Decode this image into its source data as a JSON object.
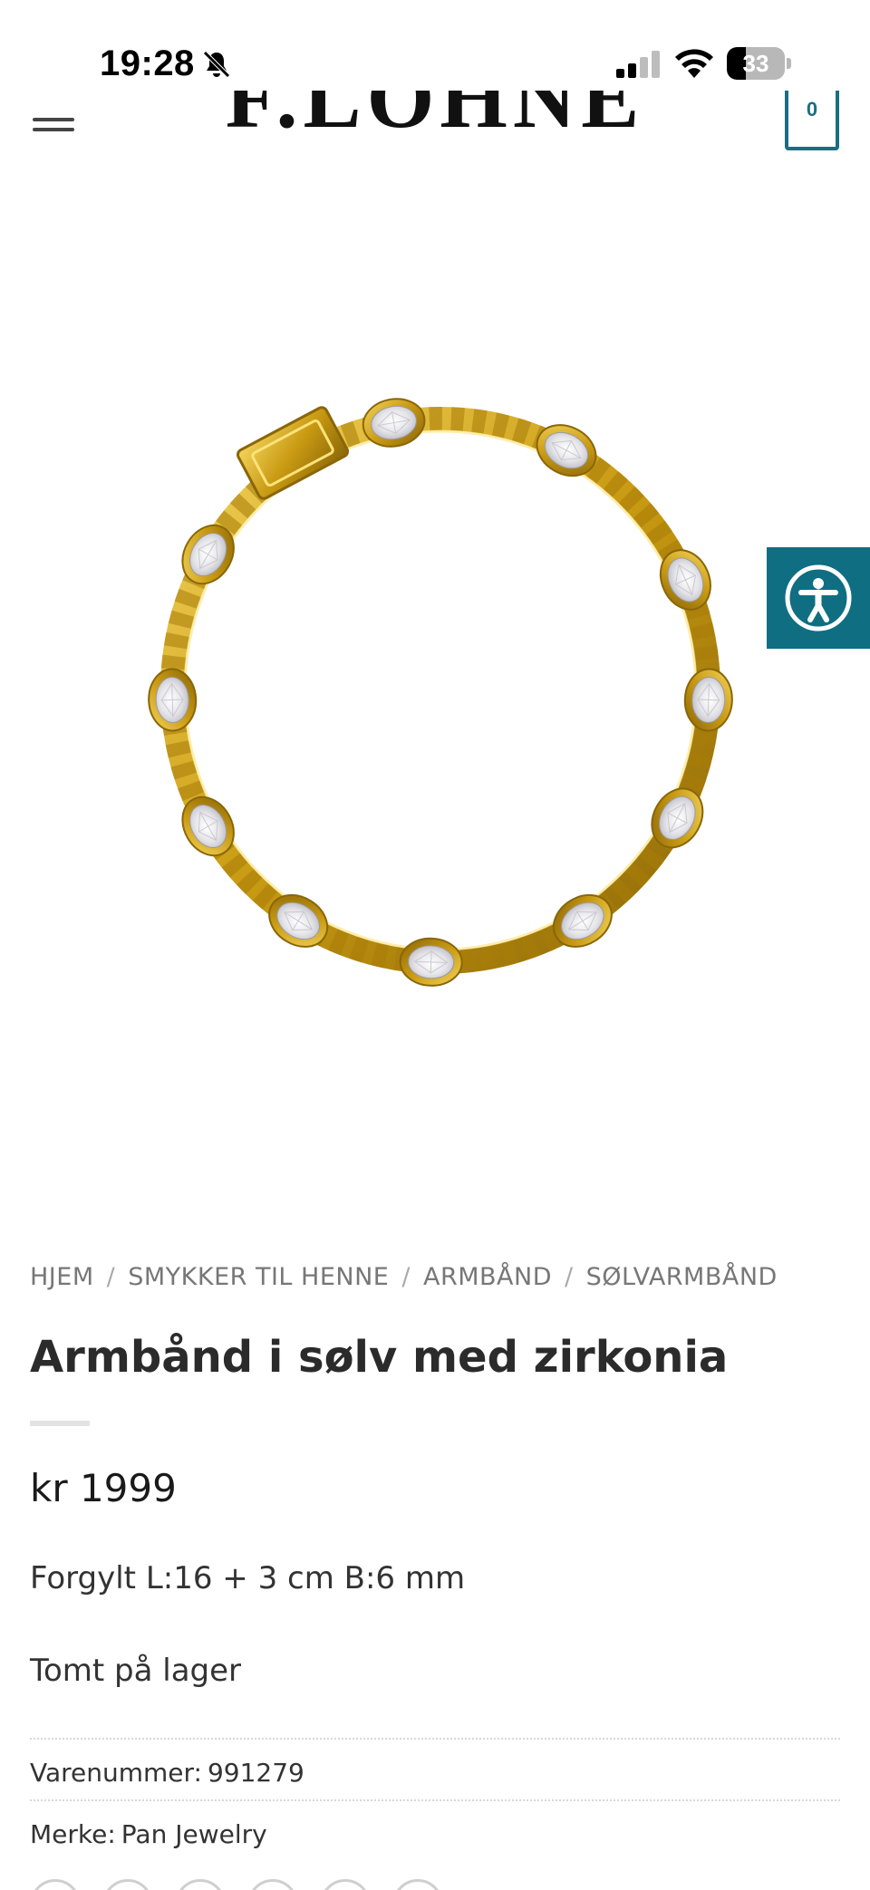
{
  "status_bar": {
    "time": "19:28",
    "battery": "33",
    "battery_level": 0.33,
    "icons": [
      "bell-slash-icon",
      "cellular-signal-icon",
      "wifi-icon",
      "battery-icon"
    ]
  },
  "header": {
    "logo": "F.LOHNE",
    "cart_count": "0",
    "icons": [
      "hamburger-menu-icon",
      "cart-icon"
    ]
  },
  "product_image": {
    "alt_icon": "bracelet-image"
  },
  "accessibility": {
    "icon": "accessibility-icon",
    "color": "#0f6e82"
  },
  "breadcrumb": {
    "items": [
      "HJEM",
      "SMYKKER TIL HENNE",
      "ARMBÅND",
      "SØLVARMBÅND"
    ],
    "separator": "/"
  },
  "product": {
    "title": "Armbånd i sølv med zirkonia",
    "price": "kr 1999",
    "description": "Forgylt L:16 + 3 cm B:6 mm",
    "stock": "Tomt på lager",
    "sku_label": "Varenummer:",
    "sku_value": "991279",
    "brand_label": "Merke:",
    "brand_value": "Pan Jewelry"
  },
  "colors": {
    "accent": "#1a6e82",
    "gold": "#d4a81c"
  }
}
